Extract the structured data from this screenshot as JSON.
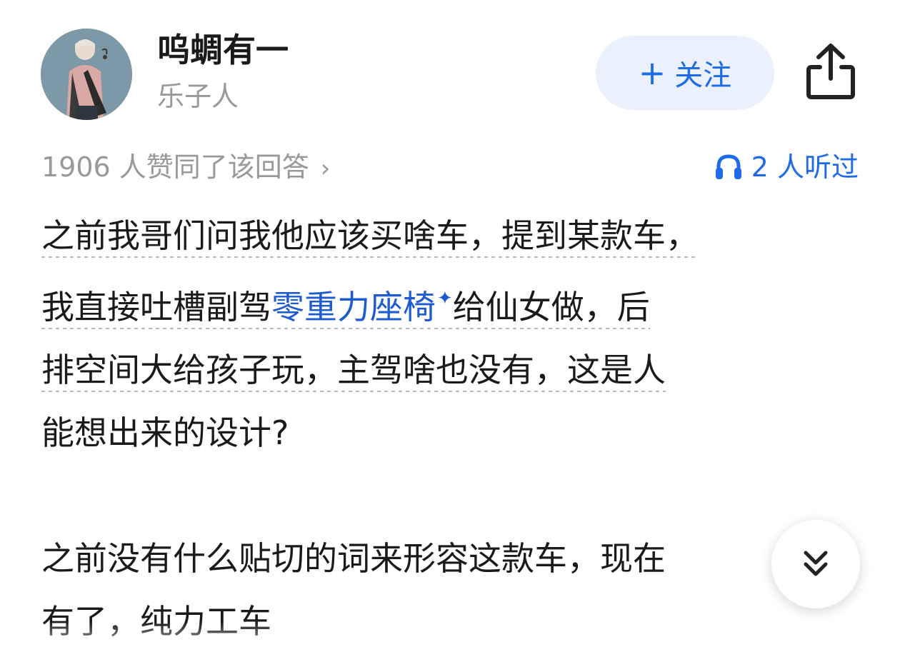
{
  "author": {
    "name": "呜蜩有一",
    "bio": "乐子人",
    "avatar_icon": "avatar-illustration"
  },
  "follow_button": {
    "plus": "+",
    "label": "关注"
  },
  "share_icon": "share-icon",
  "meta": {
    "upvotes": "1906 人赞同了该回答",
    "upvotes_chevron": "›",
    "listen_icon": "headphones-icon",
    "listened": "2 人听过"
  },
  "answer": {
    "p1_a": "之前我哥们问我他应该买啥车，提到某款车，",
    "p1_b": "我直接吐槽副驾",
    "p1_keyword": "零重力座椅",
    "p1_spark": "✦",
    "p1_c": "给仙女做，后",
    "p1_d": "排空间大给孩子玩，主驾啥也没有，这是人",
    "p1_e": "能想出来的设计?",
    "p2_a": "之前没有什么贴切的词来形容这款车，现在",
    "p2_b": "有了，纯力工车"
  },
  "scroll_button": {
    "icon": "double-chevron-down-icon"
  },
  "colors": {
    "accent": "#1f6ae6",
    "follow_bg": "#eaf1fd",
    "muted": "#999999",
    "text": "#1a1a1a"
  }
}
